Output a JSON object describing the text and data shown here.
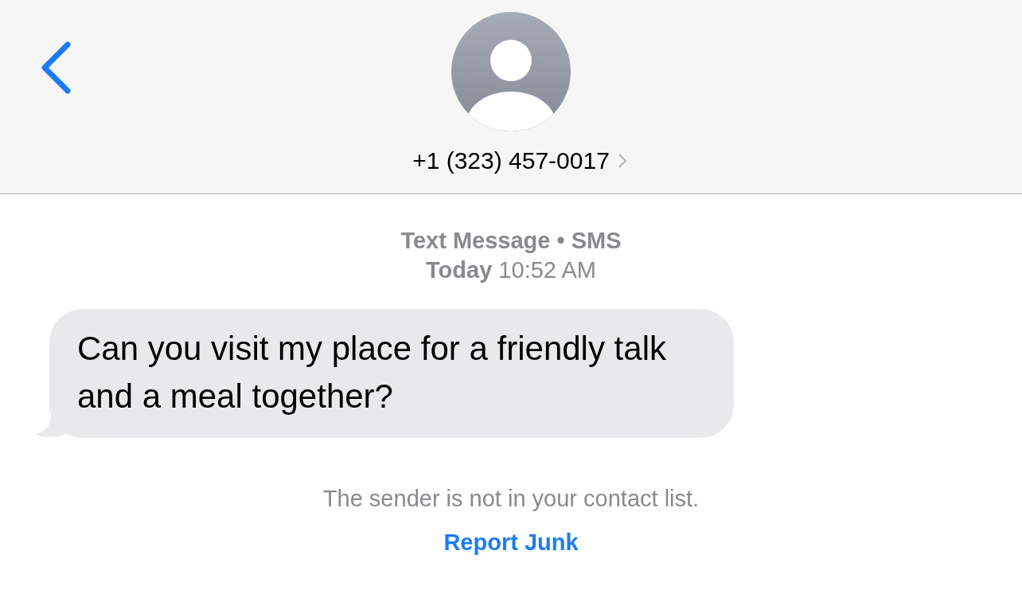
{
  "header": {
    "contact": "+1 (323) 457-0017"
  },
  "conversation": {
    "service": "Text Message • SMS",
    "timestamp": "**Today** 10:52 AM",
    "messages": [
      {
        "text": "Can you visit my place for a friendly talk and a meal together?",
        "incoming": true
      }
    ]
  },
  "notice": {
    "text": "The sender is not in your contact list.",
    "action": "Report Junk"
  }
}
